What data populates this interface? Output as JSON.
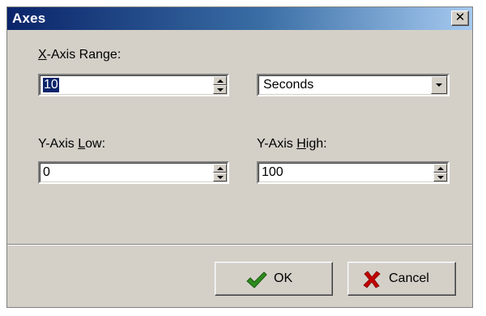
{
  "dialog": {
    "title": "Axes",
    "close_glyph": "✕"
  },
  "fields": {
    "x_range": {
      "label_pre": "",
      "label_u": "X",
      "label_post": "-Axis Range:",
      "value": "10"
    },
    "units": {
      "value": "Seconds"
    },
    "y_low": {
      "label_pre": "Y-Axis ",
      "label_u": "L",
      "label_post": "ow:",
      "value": "0"
    },
    "y_high": {
      "label_pre": "Y-Axis ",
      "label_u": "H",
      "label_post": "igh:",
      "value": "100"
    }
  },
  "buttons": {
    "ok": {
      "label": "OK",
      "icon": "checkmark-icon"
    },
    "cancel": {
      "label": "Cancel",
      "icon": "x-icon"
    }
  },
  "colors": {
    "title_start": "#0a246a",
    "title_end": "#a6caf0",
    "face": "#d4d0c8",
    "ok_icon": "#2e8b1e",
    "cancel_icon": "#c40000"
  }
}
